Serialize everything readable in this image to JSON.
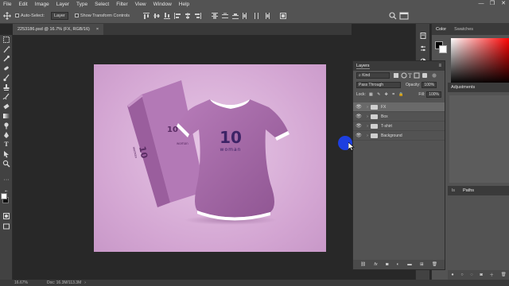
{
  "menubar": {
    "items": [
      "File",
      "Edit",
      "Image",
      "Layer",
      "Type",
      "Select",
      "Filter",
      "View",
      "Window",
      "Help"
    ]
  },
  "options": {
    "auto_select_label": "Auto-Select:",
    "auto_select_value": "Layer",
    "transform_controls_label": "Show Transform Controls"
  },
  "document": {
    "tab_title": "2253186.psd @ 16.7% (FX, RGB/16)",
    "tab_close": "×"
  },
  "status": {
    "zoom": "16.67%",
    "doc_size": "Doc: 16.3M/113.3M"
  },
  "layers_panel": {
    "title": "Layers",
    "kind_filter": "Kind",
    "blend_mode": "Pass Through",
    "opacity_label": "Opacity:",
    "opacity_value": "100%",
    "lock_label": "Lock:",
    "fill_label": "Fill:",
    "fill_value": "100%",
    "layers": [
      {
        "name": "FX",
        "visible": true,
        "active": true
      },
      {
        "name": "Box",
        "visible": true,
        "active": false
      },
      {
        "name": "T-shirt",
        "visible": true,
        "active": false
      },
      {
        "name": "Background",
        "visible": true,
        "active": false
      }
    ],
    "footer_icons": [
      "link-icon",
      "fx-icon",
      "mask-icon",
      "adjustment-icon",
      "group-icon",
      "new-layer-icon",
      "trash-icon"
    ]
  },
  "right_panel": {
    "tab_color": "Color",
    "tab_swatches": "Swatches",
    "tab_adjustments": "Adjustments",
    "tab_channels_partial": "ls",
    "tab_paths": "Paths"
  },
  "artwork": {
    "shirt_number": "10",
    "shirt_text": "woman",
    "box_number": "10",
    "box_text": "woman",
    "shirt_color": "#a265a5",
    "box_color": "#b377b6"
  }
}
